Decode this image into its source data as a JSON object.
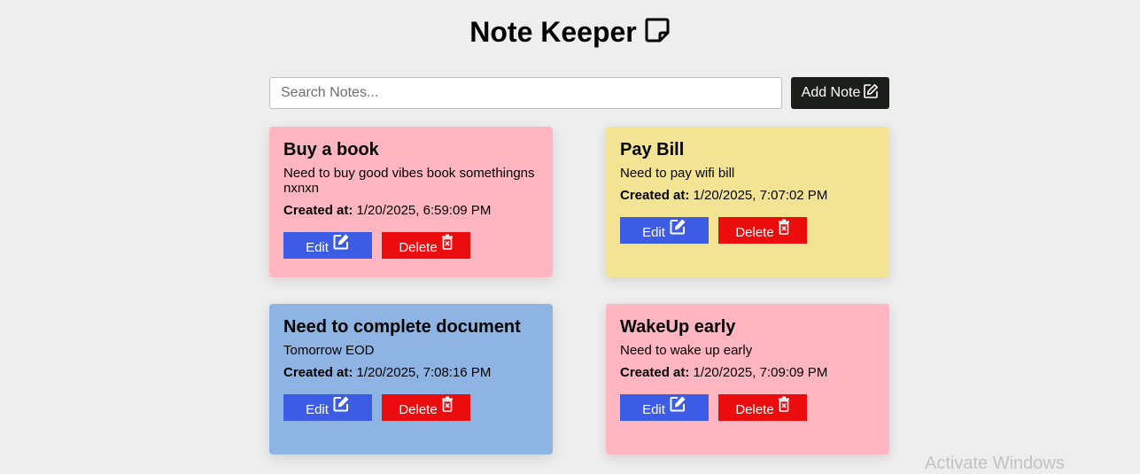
{
  "header": {
    "title": "Note Keeper",
    "icon": "sticky-note-icon"
  },
  "toolbar": {
    "search_placeholder": "Search Notes...",
    "search_value": "",
    "add_label": "Add Note"
  },
  "notes": [
    {
      "title": "Buy a book",
      "description": "Need to buy good vibes book somethingnsnxnxn",
      "created_label": "Created at:",
      "created_value": "1/20/2025, 6:59:09 PM",
      "color": "#ffb6c1",
      "edit_label": "Edit",
      "delete_label": "Delete"
    },
    {
      "title": "Pay Bill",
      "description": "Need to pay wifi bill",
      "created_label": "Created at:",
      "created_value": "1/20/2025, 7:07:02 PM",
      "color": "#f2e492",
      "edit_label": "Edit",
      "delete_label": "Delete"
    },
    {
      "title": "Need to complete document",
      "description": "Tomorrow EOD",
      "created_label": "Created at:",
      "created_value": "1/20/2025, 7:08:16 PM",
      "color": "#8db4e2",
      "edit_label": "Edit",
      "delete_label": "Delete"
    },
    {
      "title": "WakeUp early",
      "description": "Need to wake up early",
      "created_label": "Created at:",
      "created_value": "1/20/2025, 7:09:09 PM",
      "color": "#ffb6c1",
      "edit_label": "Edit",
      "delete_label": "Delete"
    }
  ],
  "colors": {
    "edit_button": "#3d5ce6",
    "delete_button": "#eb0d0d",
    "add_button": "#1c1e1b",
    "background": "#eeeeee"
  },
  "watermark": "Activate Windows"
}
